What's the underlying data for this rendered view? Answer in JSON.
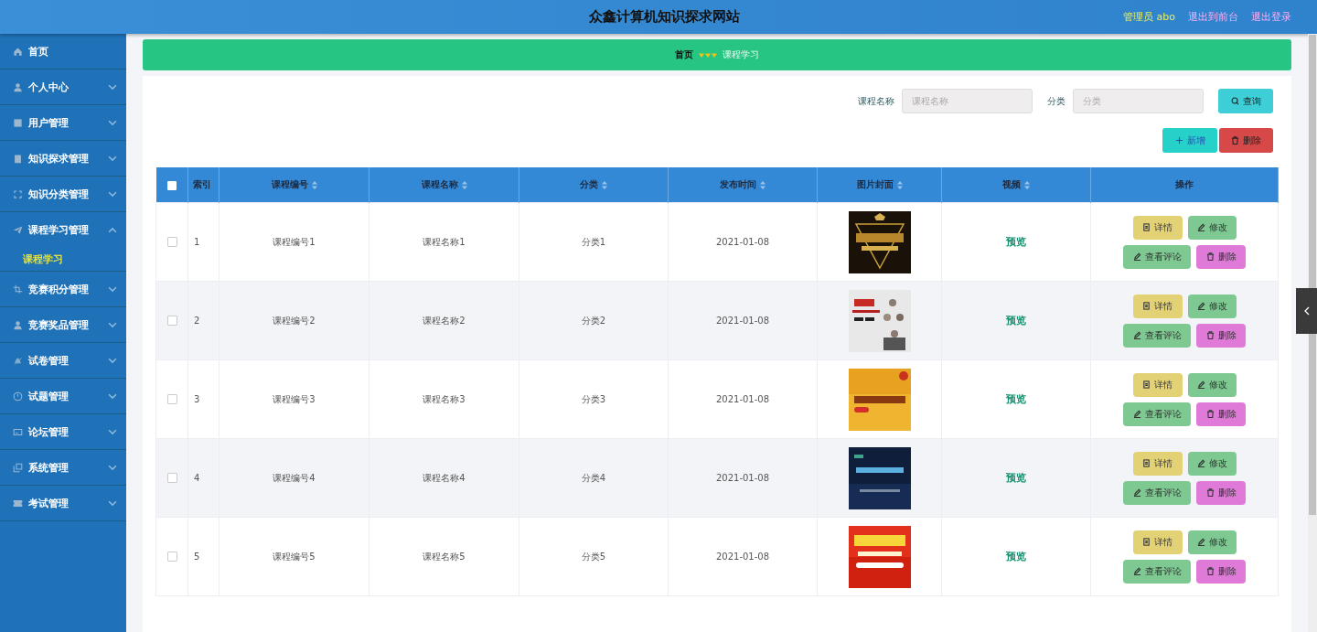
{
  "header": {
    "title": "众鑫计算机知识探求网站",
    "user": "管理员 abo",
    "links": [
      "退出到前台",
      "退出登录"
    ]
  },
  "sidebar": {
    "items": [
      {
        "label": "首页"
      },
      {
        "label": "个人中心",
        "expanded": false
      },
      {
        "label": "用户管理",
        "expanded": false
      },
      {
        "label": "知识探求管理",
        "expanded": false
      },
      {
        "label": "知识分类管理",
        "expanded": false
      },
      {
        "label": "课程学习管理",
        "expanded": true,
        "children": [
          {
            "label": "课程学习",
            "selected": true
          }
        ]
      },
      {
        "label": "竞赛积分管理",
        "expanded": false
      },
      {
        "label": "竞赛奖品管理",
        "expanded": false
      },
      {
        "label": "试卷管理",
        "expanded": false
      },
      {
        "label": "试题管理",
        "expanded": false
      },
      {
        "label": "论坛管理",
        "expanded": false
      },
      {
        "label": "系统管理",
        "expanded": false
      },
      {
        "label": "考试管理",
        "expanded": false
      }
    ]
  },
  "breadcrumb": [
    "首页",
    "课程学习"
  ],
  "search": {
    "fields": [
      {
        "label": "课程名称",
        "placeholder": "课程名称"
      },
      {
        "label": "分类",
        "placeholder": "分类"
      }
    ],
    "button": "查询"
  },
  "actions": [
    {
      "label": "新增",
      "kind": "add"
    },
    {
      "label": "删除",
      "kind": "delete"
    }
  ],
  "table": {
    "select_all": {
      "checked": false
    },
    "columns": [
      {
        "label": "索引",
        "sortable": false
      },
      {
        "label": "课程编号",
        "sortable": true
      },
      {
        "label": "课程名称",
        "sortable": true
      },
      {
        "label": "分类",
        "sortable": true
      },
      {
        "label": "发布时间",
        "sortable": true
      },
      {
        "label": "图片封面",
        "sortable": true
      },
      {
        "label": "视频",
        "sortable": true
      },
      {
        "label": "操作",
        "sortable": false
      }
    ],
    "rows": [
      {
        "checked": false,
        "index": "1",
        "code": "课程编号1",
        "name": "课程名称1",
        "category": "分类1",
        "date": "2021-01-08",
        "cover": {
          "kind": "picture"
        },
        "video": "预览",
        "buttons": [
          {
            "label": "详情",
            "kind": "detail"
          },
          {
            "label": "修改",
            "kind": "edit"
          },
          {
            "label": "查看评论",
            "kind": "comment"
          },
          {
            "label": "删除",
            "kind": "delete"
          }
        ]
      },
      {
        "checked": false,
        "index": "2",
        "code": "课程编号2",
        "name": "课程名称2",
        "category": "分类2",
        "date": "2021-01-08",
        "cover": {
          "kind": "picture"
        },
        "video": "预览",
        "buttons": [
          {
            "label": "详情",
            "kind": "detail"
          },
          {
            "label": "修改",
            "kind": "edit"
          },
          {
            "label": "查看评论",
            "kind": "comment"
          },
          {
            "label": "删除",
            "kind": "delete"
          }
        ]
      },
      {
        "checked": false,
        "index": "3",
        "code": "课程编号3",
        "name": "课程名称3",
        "category": "分类3",
        "date": "2021-01-08",
        "cover": {
          "kind": "picture"
        },
        "video": "预览",
        "buttons": [
          {
            "label": "详情",
            "kind": "detail"
          },
          {
            "label": "修改",
            "kind": "edit"
          },
          {
            "label": "查看评论",
            "kind": "comment"
          },
          {
            "label": "删除",
            "kind": "delete"
          }
        ]
      },
      {
        "checked": false,
        "index": "4",
        "code": "课程编号4",
        "name": "课程名称4",
        "category": "分类4",
        "date": "2021-01-08",
        "cover": {
          "kind": "picture"
        },
        "video": "预览",
        "buttons": [
          {
            "label": "详情",
            "kind": "detail"
          },
          {
            "label": "修改",
            "kind": "edit"
          },
          {
            "label": "查看评论",
            "kind": "comment"
          },
          {
            "label": "删除",
            "kind": "delete"
          }
        ]
      },
      {
        "checked": false,
        "index": "5",
        "code": "课程编号5",
        "name": "课程名称5",
        "category": "分类5",
        "date": "2021-01-08",
        "cover": {
          "kind": "picture"
        },
        "video": "预览",
        "buttons": [
          {
            "label": "详情",
            "kind": "detail"
          },
          {
            "label": "修改",
            "kind": "edit"
          },
          {
            "label": "查看评论",
            "kind": "comment"
          },
          {
            "label": "删除",
            "kind": "delete"
          }
        ]
      }
    ]
  }
}
